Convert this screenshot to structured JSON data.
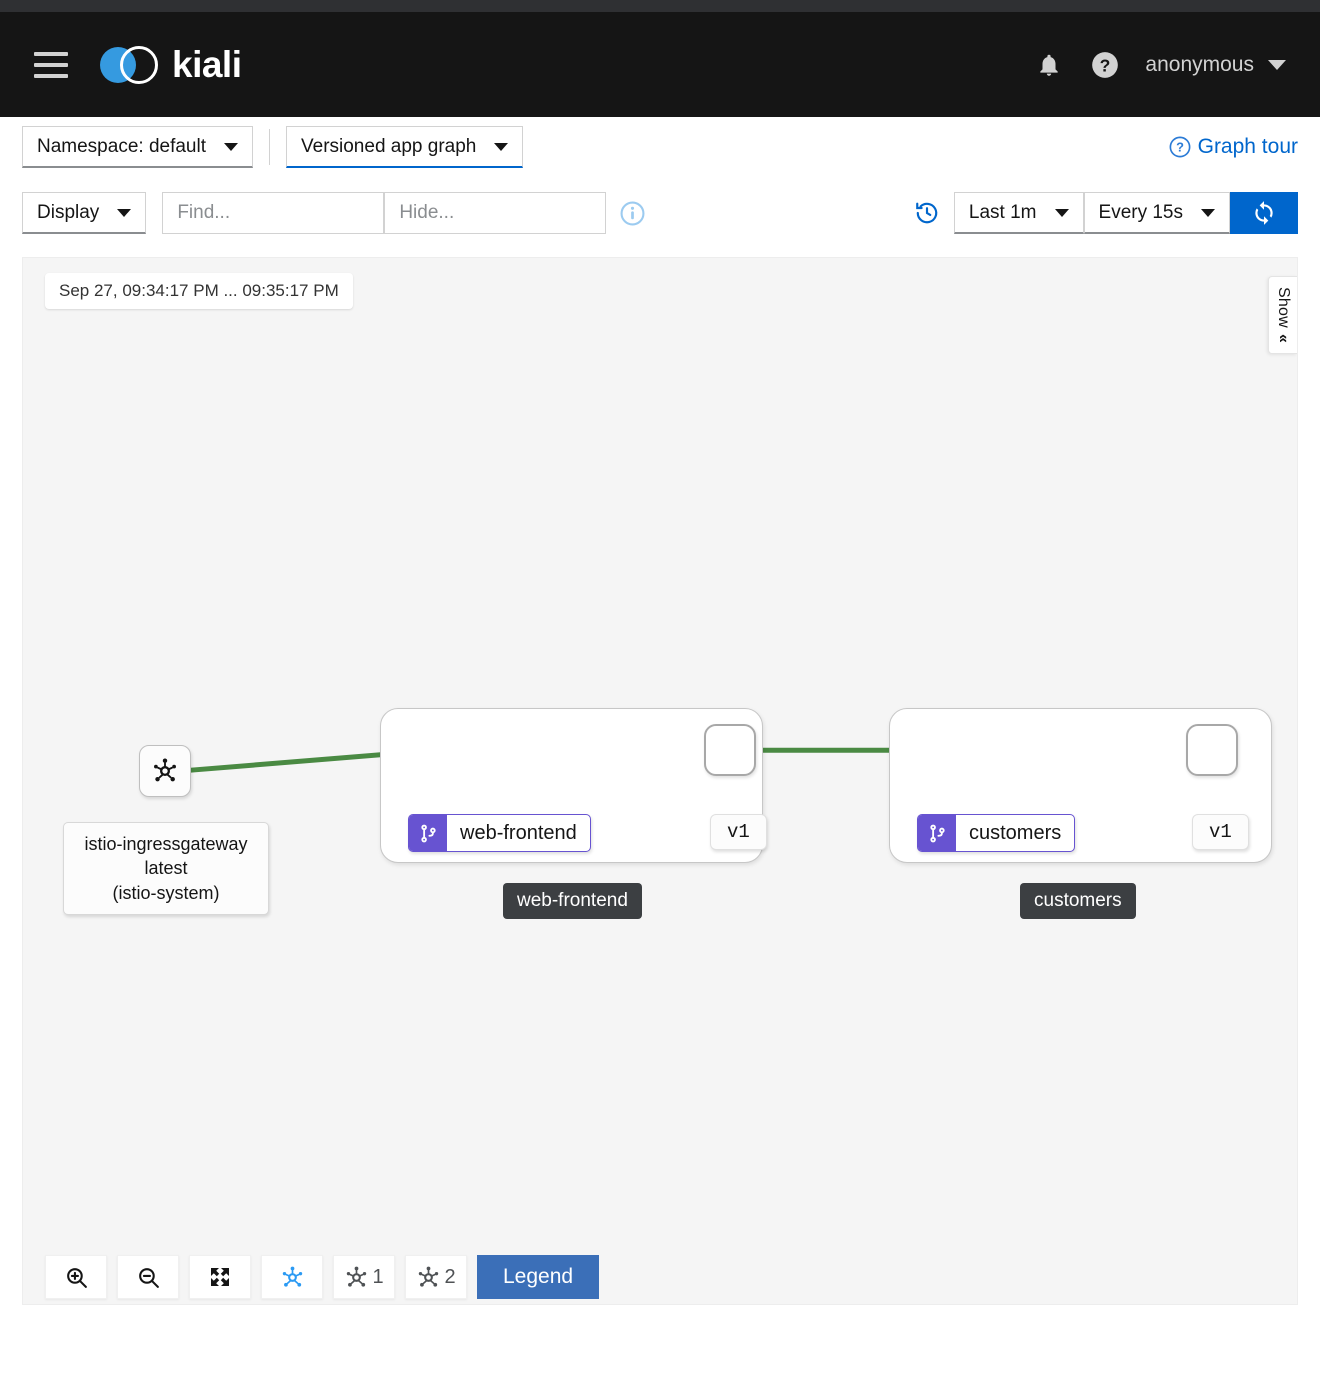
{
  "window": {
    "titlebar_color": "#2f3033"
  },
  "masthead": {
    "brand": "kiali",
    "menu_icon": "hamburger-icon",
    "bell_icon": "bell-icon",
    "help_icon": "question-circle-icon",
    "username": "anonymous",
    "user_caret_icon": "caret-down-icon"
  },
  "toolbar": {
    "namespace_select": "Namespace: default",
    "graph_type_select": "Versioned app graph",
    "graph_tour": "Graph tour",
    "graph_tour_icon": "question-circle-icon",
    "display_select": "Display",
    "find_placeholder": "Find...",
    "find_value": "",
    "hide_placeholder": "Hide...",
    "hide_value": "",
    "info_icon": "info-circle-icon",
    "history_icon": "history-icon",
    "time_range_select": "Last 1m",
    "refresh_interval_select": "Every 15s",
    "refresh_icon": "sync-icon"
  },
  "graph": {
    "time_chip": "Sep 27, 09:34:17 PM ... 09:35:17 PM",
    "side_panel_toggle": {
      "label": "Show",
      "icon": "double-chevron-left-icon"
    },
    "accent_green": "#4a8a43",
    "accent_purple": "#6753d1",
    "nodes": {
      "ingressgateway": {
        "icon": "service-mesh-node-icon",
        "label": "istio-ingressgateway\nlatest\n(istio-system)"
      },
      "web_frontend": {
        "group_label": "web-frontend",
        "service_badge_icon": "code-branch-icon",
        "service_name": "web-frontend",
        "version": "v1"
      },
      "customers": {
        "group_label": "customers",
        "service_badge_icon": "code-branch-icon",
        "service_name": "customers",
        "version": "v1"
      }
    }
  },
  "bottom_toolbar": {
    "zoom_in_icon": "zoom-in-icon",
    "zoom_out_icon": "zoom-out-icon",
    "fit_icon": "expand-arrows-icon",
    "layout_default_icon": "topology-icon",
    "layout_1_icon": "topology-icon",
    "layout_1_label": "1",
    "layout_2_icon": "topology-icon",
    "layout_2_label": "2",
    "legend_label": "Legend"
  }
}
